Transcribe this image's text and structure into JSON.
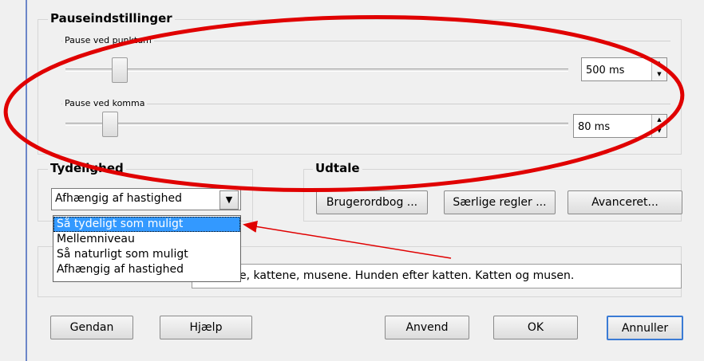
{
  "pause_group": {
    "title": "Pauseindstillinger",
    "period": {
      "label": "Pause ved punktum",
      "value": "500 ms",
      "level_percent": 11
    },
    "comma": {
      "label": "Pause ved komma",
      "value": "80 ms",
      "level_percent": 10
    }
  },
  "clarity_group": {
    "title": "Tydelighed",
    "selected": "Afhængig af hastighed",
    "options": [
      "Så tydeligt som muligt",
      "Mellemniveau",
      "Så naturligt som muligt",
      "Afhængig af hastighed"
    ],
    "highlighted_index": 0
  },
  "pronunciation_group": {
    "title": "Udtale",
    "buttons": [
      "Brugerordbog ...",
      "Særlige regler ...",
      "Avanceret..."
    ]
  },
  "sample_text": "hundene, kattene, musene. Hunden efter katten. Katten og musen.",
  "footer_buttons": {
    "restore": "Gendan",
    "help": "Hjælp",
    "apply": "Anvend",
    "ok": "OK",
    "cancel": "Annuller"
  },
  "icons": {
    "spin_up": "▲",
    "spin_down": "▼",
    "dropdown_arrow": "▼"
  },
  "annotation_color": "#e00000"
}
